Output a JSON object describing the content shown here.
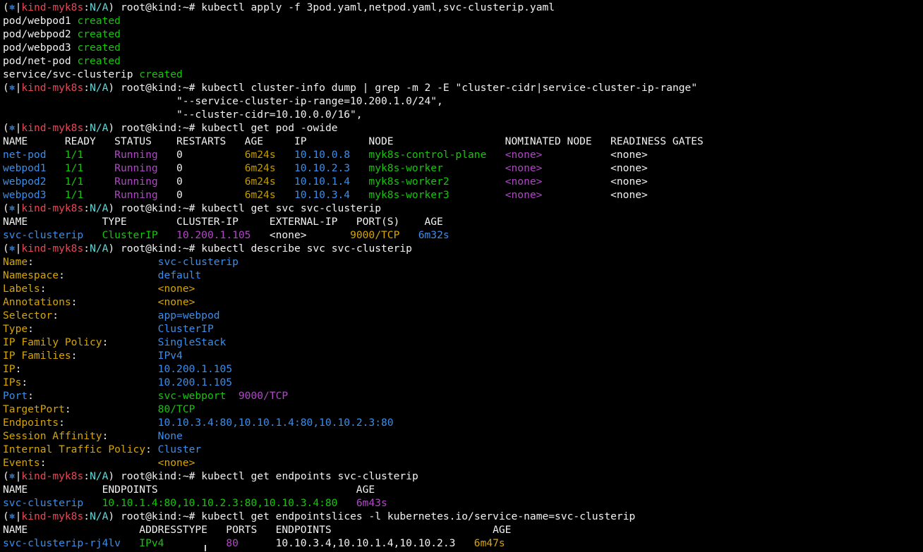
{
  "prompt": {
    "open": "(",
    "icon": "⎈",
    "sep": "|",
    "context": "kind-myk8s",
    "colon": ":",
    "namespace": "N/A",
    "close": ")",
    "user": "root@kind:~#"
  },
  "colors": {
    "background": "#000000",
    "foreground": "#cccccc",
    "context": "#e74856",
    "namespace": "#61d6d6",
    "created": "#16c60c",
    "running": "#b148c6",
    "age": "#c19c00",
    "ip": "#3b8eea"
  },
  "lines": [
    {
      "type": "prompt",
      "cmd": "kubectl apply -f 3pod.yaml,netpod.yaml,svc-clusterip.yaml"
    },
    {
      "type": "out",
      "segs": [
        {
          "t": "pod/webpod1 ",
          "c": "white"
        },
        {
          "t": "created",
          "c": "green"
        }
      ]
    },
    {
      "type": "out",
      "segs": [
        {
          "t": "pod/webpod2 ",
          "c": "white"
        },
        {
          "t": "created",
          "c": "green"
        }
      ]
    },
    {
      "type": "out",
      "segs": [
        {
          "t": "pod/webpod3 ",
          "c": "white"
        },
        {
          "t": "created",
          "c": "green"
        }
      ]
    },
    {
      "type": "out",
      "segs": [
        {
          "t": "pod/net-pod ",
          "c": "white"
        },
        {
          "t": "created",
          "c": "green"
        }
      ]
    },
    {
      "type": "out",
      "segs": [
        {
          "t": "service/svc-clusterip ",
          "c": "white"
        },
        {
          "t": "created",
          "c": "green"
        }
      ]
    },
    {
      "type": "prompt",
      "cmd": "kubectl cluster-info dump | grep -m 2 -E \"cluster-cidr|service-cluster-ip-range\""
    },
    {
      "type": "out",
      "segs": [
        {
          "t": "                            \"--service-cluster-ip-range=10.200.1.0/24\",",
          "c": "white"
        }
      ]
    },
    {
      "type": "out",
      "segs": [
        {
          "t": "                            \"--cluster-cidr=10.10.0.0/16\",",
          "c": "white"
        }
      ]
    },
    {
      "type": "prompt",
      "cmd": "kubectl get pod -owide"
    },
    {
      "type": "out",
      "segs": [
        {
          "t": "NAME      READY   STATUS    RESTARTS   AGE     IP          NODE                  NOMINATED NODE   READINESS GATES",
          "c": "white"
        }
      ]
    },
    {
      "type": "out",
      "segs": [
        {
          "t": "net-pod  ",
          "c": "blue"
        },
        {
          "t": " 1/1     ",
          "c": "green"
        },
        {
          "t": "Running",
          "c": "purple"
        },
        {
          "t": "   0          ",
          "c": "white"
        },
        {
          "t": "6m24s",
          "c": "yellow"
        },
        {
          "t": "   10.10.0.8",
          "c": "blue"
        },
        {
          "t": "   myk8s-control-plane",
          "c": "green"
        },
        {
          "t": "   <none>",
          "c": "purple"
        },
        {
          "t": "           <none>",
          "c": "white"
        }
      ]
    },
    {
      "type": "out",
      "segs": [
        {
          "t": "webpod1  ",
          "c": "blue"
        },
        {
          "t": " 1/1     ",
          "c": "green"
        },
        {
          "t": "Running",
          "c": "purple"
        },
        {
          "t": "   0          ",
          "c": "white"
        },
        {
          "t": "6m24s",
          "c": "yellow"
        },
        {
          "t": "   10.10.2.3",
          "c": "blue"
        },
        {
          "t": "   myk8s-worker       ",
          "c": "green"
        },
        {
          "t": "   <none>",
          "c": "purple"
        },
        {
          "t": "           <none>",
          "c": "white"
        }
      ]
    },
    {
      "type": "out",
      "segs": [
        {
          "t": "webpod2  ",
          "c": "blue"
        },
        {
          "t": " 1/1     ",
          "c": "green"
        },
        {
          "t": "Running",
          "c": "purple"
        },
        {
          "t": "   0          ",
          "c": "white"
        },
        {
          "t": "6m24s",
          "c": "yellow"
        },
        {
          "t": "   10.10.1.4",
          "c": "blue"
        },
        {
          "t": "   myk8s-worker2      ",
          "c": "green"
        },
        {
          "t": "   <none>",
          "c": "purple"
        },
        {
          "t": "           <none>",
          "c": "white"
        }
      ]
    },
    {
      "type": "out",
      "segs": [
        {
          "t": "webpod3  ",
          "c": "blue"
        },
        {
          "t": " 1/1     ",
          "c": "green"
        },
        {
          "t": "Running",
          "c": "purple"
        },
        {
          "t": "   0          ",
          "c": "white"
        },
        {
          "t": "6m24s",
          "c": "yellow"
        },
        {
          "t": "   10.10.3.4",
          "c": "blue"
        },
        {
          "t": "   myk8s-worker3      ",
          "c": "green"
        },
        {
          "t": "   <none>",
          "c": "purple"
        },
        {
          "t": "           <none>",
          "c": "white"
        }
      ]
    },
    {
      "type": "prompt",
      "cmd": "kubectl get svc svc-clusterip"
    },
    {
      "type": "out",
      "segs": [
        {
          "t": "NAME            TYPE        CLUSTER-IP     EXTERNAL-IP   PORT(S)    AGE",
          "c": "white"
        }
      ]
    },
    {
      "type": "out",
      "segs": [
        {
          "t": "svc-clusterip",
          "c": "blue"
        },
        {
          "t": "   ClusterIP",
          "c": "green"
        },
        {
          "t": "   10.200.1.105",
          "c": "purple"
        },
        {
          "t": "   <none>       ",
          "c": "white"
        },
        {
          "t": "9000/TCP",
          "c": "orange"
        },
        {
          "t": "   6m32s",
          "c": "blue"
        }
      ]
    },
    {
      "type": "prompt",
      "cmd": "kubectl describe svc svc-clusterip"
    },
    {
      "type": "out",
      "segs": [
        {
          "t": "Name",
          "c": "orange"
        },
        {
          "t": ":                    ",
          "c": "white"
        },
        {
          "t": "svc-clusterip",
          "c": "blue"
        }
      ]
    },
    {
      "type": "out",
      "segs": [
        {
          "t": "Namespace",
          "c": "orange"
        },
        {
          "t": ":               ",
          "c": "white"
        },
        {
          "t": "default",
          "c": "blue"
        }
      ]
    },
    {
      "type": "out",
      "segs": [
        {
          "t": "Labels",
          "c": "orange"
        },
        {
          "t": ":                  ",
          "c": "white"
        },
        {
          "t": "<none>",
          "c": "orange"
        }
      ]
    },
    {
      "type": "out",
      "segs": [
        {
          "t": "Annotations",
          "c": "orange"
        },
        {
          "t": ":             ",
          "c": "white"
        },
        {
          "t": "<none>",
          "c": "orange"
        }
      ]
    },
    {
      "type": "out",
      "segs": [
        {
          "t": "Selector",
          "c": "orange"
        },
        {
          "t": ":                ",
          "c": "white"
        },
        {
          "t": "app=webpod",
          "c": "blue"
        }
      ]
    },
    {
      "type": "out",
      "segs": [
        {
          "t": "Type",
          "c": "orange"
        },
        {
          "t": ":                    ",
          "c": "white"
        },
        {
          "t": "ClusterIP",
          "c": "blue"
        }
      ]
    },
    {
      "type": "out",
      "segs": [
        {
          "t": "IP Family Policy",
          "c": "orange"
        },
        {
          "t": ":        ",
          "c": "white"
        },
        {
          "t": "SingleStack",
          "c": "blue"
        }
      ]
    },
    {
      "type": "out",
      "segs": [
        {
          "t": "IP Families",
          "c": "orange"
        },
        {
          "t": ":             ",
          "c": "white"
        },
        {
          "t": "IPv4",
          "c": "blue"
        }
      ]
    },
    {
      "type": "out",
      "segs": [
        {
          "t": "IP",
          "c": "orange"
        },
        {
          "t": ":                      ",
          "c": "white"
        },
        {
          "t": "10.200.1.105",
          "c": "blue"
        }
      ]
    },
    {
      "type": "out",
      "segs": [
        {
          "t": "IPs",
          "c": "orange"
        },
        {
          "t": ":                     ",
          "c": "white"
        },
        {
          "t": "10.200.1.105",
          "c": "blue"
        }
      ]
    },
    {
      "type": "out",
      "segs": [
        {
          "t": "Port",
          "c": "blue"
        },
        {
          "t": ":                    ",
          "c": "white"
        },
        {
          "t": "svc-webport",
          "c": "green"
        },
        {
          "t": "  9000/TCP",
          "c": "purple"
        }
      ]
    },
    {
      "type": "out",
      "segs": [
        {
          "t": "TargetPort",
          "c": "orange"
        },
        {
          "t": ":              ",
          "c": "white"
        },
        {
          "t": "80/TCP",
          "c": "green"
        }
      ]
    },
    {
      "type": "out",
      "segs": [
        {
          "t": "Endpoints",
          "c": "orange"
        },
        {
          "t": ":               ",
          "c": "white"
        },
        {
          "t": "10.10.3.4:80,10.10.1.4:80,10.10.2.3:80",
          "c": "blue"
        }
      ]
    },
    {
      "type": "out",
      "segs": [
        {
          "t": "Session Affinity",
          "c": "orange"
        },
        {
          "t": ":        ",
          "c": "white"
        },
        {
          "t": "None",
          "c": "blue"
        }
      ]
    },
    {
      "type": "out",
      "segs": [
        {
          "t": "Internal Traffic Policy",
          "c": "orange"
        },
        {
          "t": ": ",
          "c": "white"
        },
        {
          "t": "Cluster",
          "c": "blue"
        }
      ]
    },
    {
      "type": "out",
      "segs": [
        {
          "t": "Events",
          "c": "orange"
        },
        {
          "t": ":                  ",
          "c": "white"
        },
        {
          "t": "<none>",
          "c": "orange"
        }
      ]
    },
    {
      "type": "prompt",
      "cmd": "kubectl get endpoints svc-clusterip"
    },
    {
      "type": "out",
      "segs": [
        {
          "t": "NAME            ENDPOINTS                                AGE",
          "c": "white"
        }
      ]
    },
    {
      "type": "out",
      "segs": [
        {
          "t": "svc-clusterip",
          "c": "blue"
        },
        {
          "t": "   10.10.1.4:80,10.10.2.3:80,10.10.3.4:80",
          "c": "green"
        },
        {
          "t": "   6m43s",
          "c": "purple"
        }
      ]
    },
    {
      "type": "prompt",
      "cmd": "kubectl get endpointslices -l kubernetes.io/service-name=svc-clusterip"
    },
    {
      "type": "out",
      "segs": [
        {
          "t": "NAME                  ADDRESSTYPE   PORTS   ENDPOINTS                          AGE",
          "c": "white"
        }
      ]
    },
    {
      "type": "out",
      "segs": [
        {
          "t": "svc-clusterip-rj4lv",
          "c": "blue"
        },
        {
          "t": "   IPv4",
          "c": "green"
        },
        {
          "t": "          80",
          "c": "purple"
        },
        {
          "t": "      10.10.3.4,10.10.1.4,10.10.2.3",
          "c": "white"
        },
        {
          "t": "   6m47s",
          "c": "orange"
        }
      ]
    }
  ]
}
